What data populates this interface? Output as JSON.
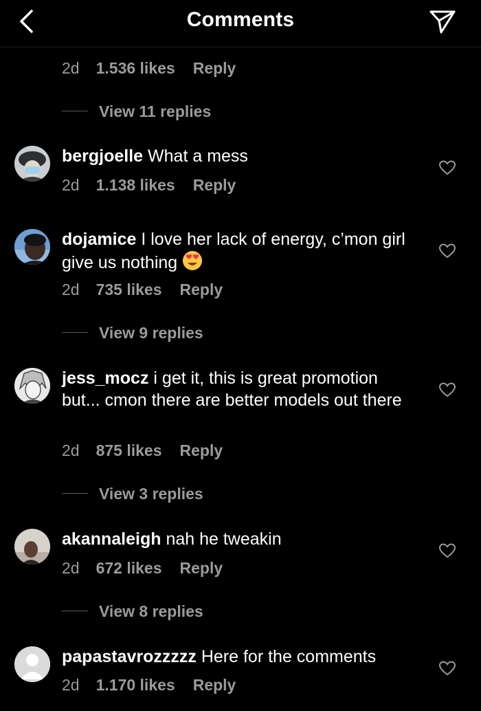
{
  "header": {
    "title": "Comments"
  },
  "top_comment": {
    "time": "2d",
    "likes": "1.536 likes",
    "reply": "Reply",
    "view_replies": "View 11 replies"
  },
  "comments": [
    {
      "username": "bergjoelle",
      "text": "What a mess",
      "time": "2d",
      "likes": "1.138 likes",
      "reply": "Reply"
    },
    {
      "username": "dojamice",
      "text": "I love her lack of energy, c’mon girl give us nothing",
      "emoji": "heart-eyes-emoji",
      "time": "2d",
      "likes": "735 likes",
      "reply": "Reply",
      "view_replies": "View 9 replies"
    },
    {
      "username": "jess_mocz",
      "text": "i get it, this is great promotion but... cmon there are better models out there",
      "time": "2d",
      "likes": "875 likes",
      "reply": "Reply",
      "view_replies": "View 3 replies"
    },
    {
      "username": "akannaleigh",
      "text": "nah he tweakin",
      "time": "2d",
      "likes": "672 likes",
      "reply": "Reply",
      "view_replies": "View 8 replies"
    },
    {
      "username": "papastavrozzzzz",
      "text": "Here for the comments",
      "time": "2d",
      "likes": "1.170 likes",
      "reply": "Reply"
    }
  ],
  "icons": {
    "back": "chevron-left-icon",
    "send": "paper-plane-icon",
    "like": "heart-outline-icon"
  },
  "colors": {
    "background": "#000000",
    "text": "#ffffff",
    "secondary": "#9b9b9b"
  }
}
